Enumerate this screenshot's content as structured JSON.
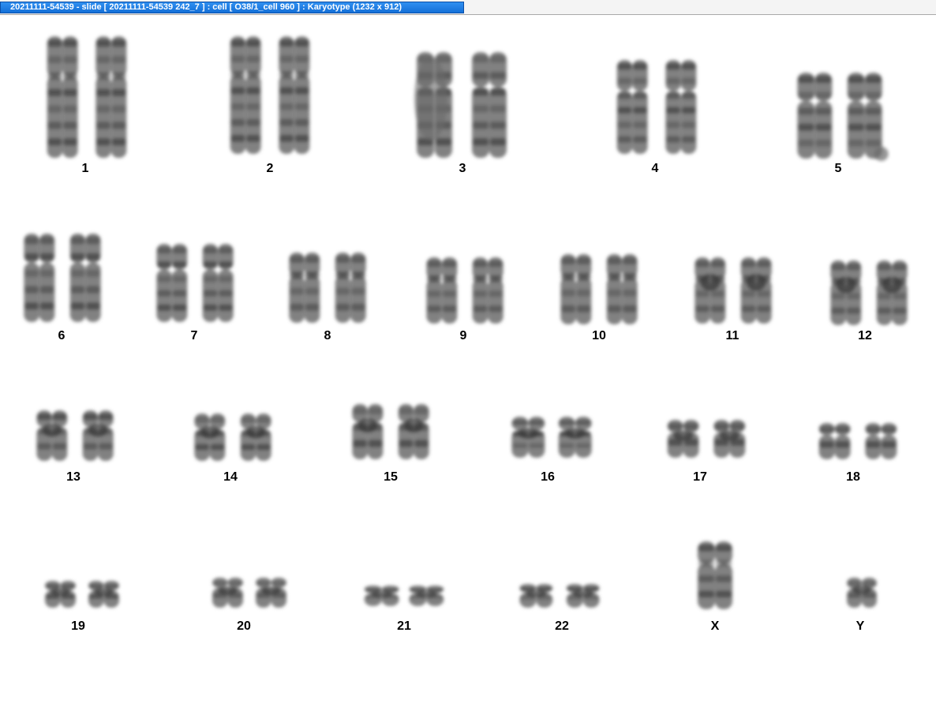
{
  "window": {
    "title": "20211111-54539 - slide [ 20211111-54539 242_7 ] : cell [ O38/1_cell 960 ] : Karyotype  (1232 x 912)"
  },
  "karyotype": {
    "chromosomes": [
      {
        "label": "1"
      },
      {
        "label": "2"
      },
      {
        "label": "3"
      },
      {
        "label": "4"
      },
      {
        "label": "5"
      },
      {
        "label": "6"
      },
      {
        "label": "7"
      },
      {
        "label": "8"
      },
      {
        "label": "9"
      },
      {
        "label": "10"
      },
      {
        "label": "11"
      },
      {
        "label": "12"
      },
      {
        "label": "13"
      },
      {
        "label": "14"
      },
      {
        "label": "15"
      },
      {
        "label": "16"
      },
      {
        "label": "17"
      },
      {
        "label": "18"
      },
      {
        "label": "19"
      },
      {
        "label": "20"
      },
      {
        "label": "21"
      },
      {
        "label": "22"
      },
      {
        "label": "X"
      },
      {
        "label": "Y"
      }
    ]
  },
  "colors": {
    "title_tab": "#1470d8",
    "chromosome": "#6b6b6b",
    "chromosome_dark": "#3a3a3a"
  }
}
